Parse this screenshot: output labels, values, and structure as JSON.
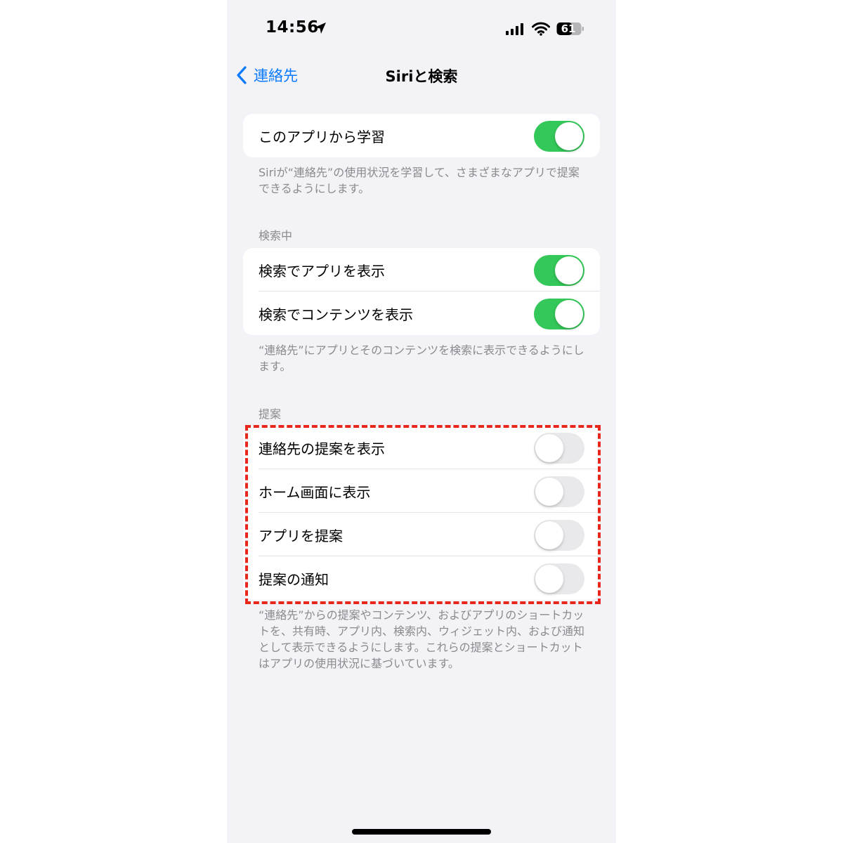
{
  "status_bar": {
    "time": "14:56",
    "battery_level": "61"
  },
  "nav": {
    "back_label": "連絡先",
    "title": "Siriと検索"
  },
  "learn_group": {
    "items": [
      {
        "label": "このアプリから学習",
        "on": true
      }
    ],
    "footer": "Siriが“連絡先”の使用状況を学習して、さまざまなアプリで提案できるようにします。"
  },
  "search_group": {
    "header": "検索中",
    "items": [
      {
        "label": "検索でアプリを表示",
        "on": true
      },
      {
        "label": "検索でコンテンツを表示",
        "on": true
      }
    ],
    "footer": "“連絡先”にアプリとそのコンテンツを検索に表示できるようにします。"
  },
  "suggest_group": {
    "header": "提案",
    "items": [
      {
        "label": "連絡先の提案を表示",
        "on": false
      },
      {
        "label": "ホーム画面に表示",
        "on": false
      },
      {
        "label": "アプリを提案",
        "on": false
      },
      {
        "label": "提案の通知",
        "on": false
      }
    ],
    "footer": "“連絡先”からの提案やコンテンツ、およびアプリのショートカットを、共有時、アプリ内、検索内、ウィジェット内、および通知として表示できるようにします。これらの提案とショートカットはアプリの使用状況に基づいています。"
  },
  "colors": {
    "toggle_on": "#34c759",
    "toggle_off": "#e9e9eb",
    "accent": "#0a7aff",
    "highlight": "#e8261b",
    "background": "#f2f2f7"
  }
}
